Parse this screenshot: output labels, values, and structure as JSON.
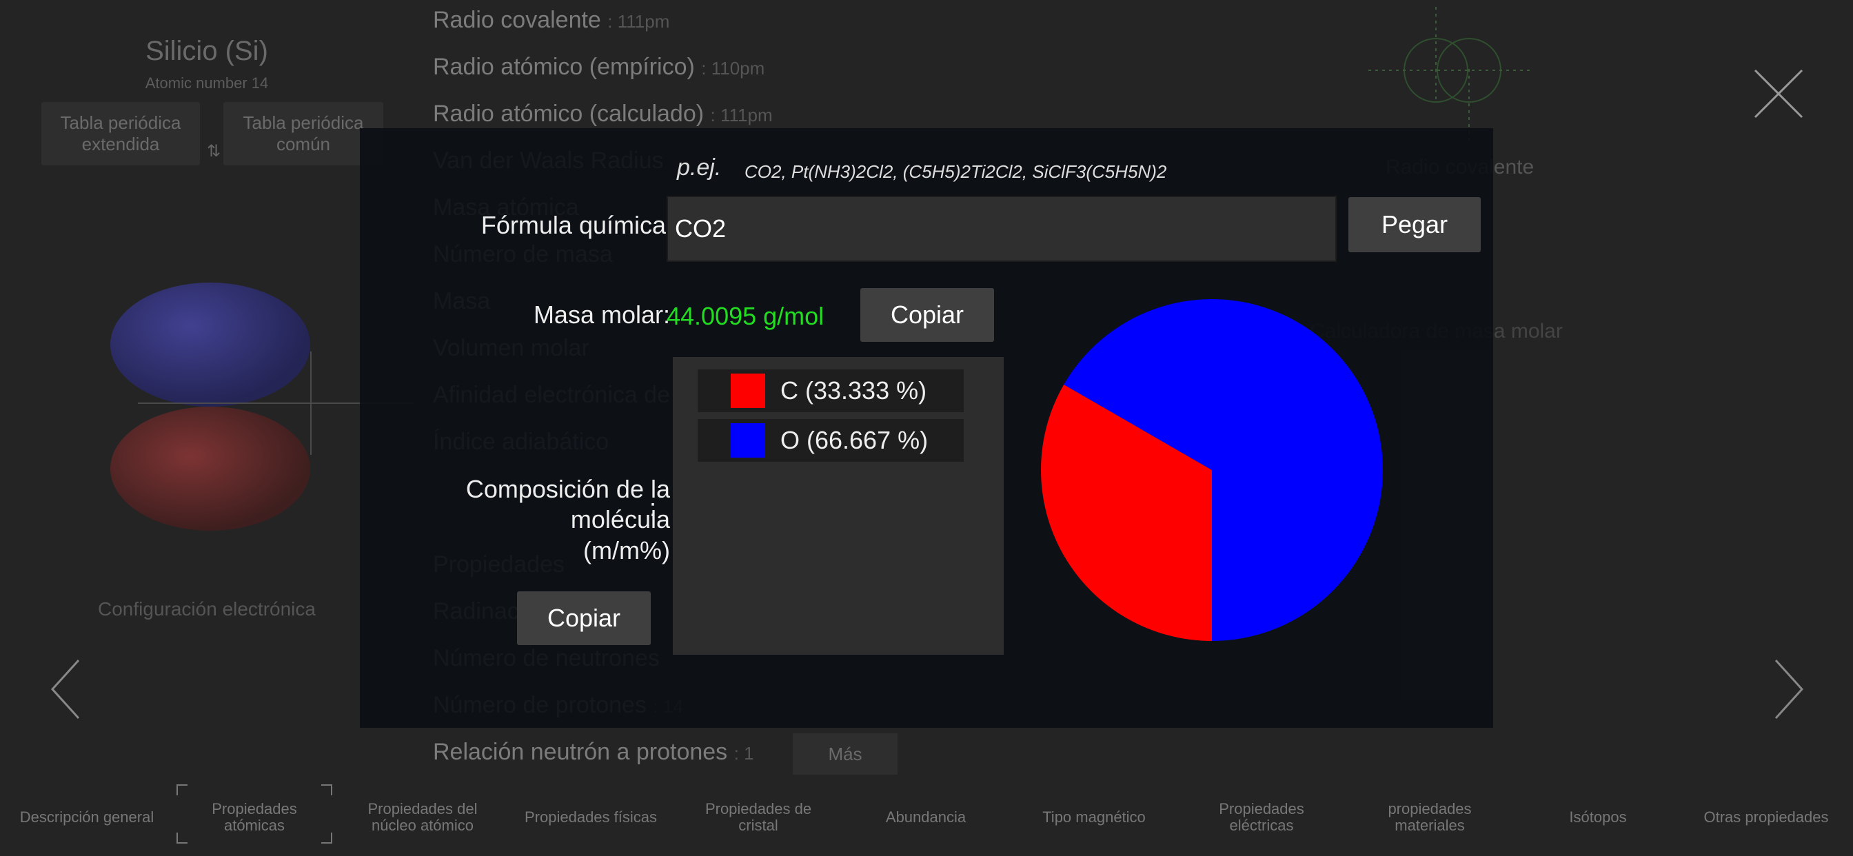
{
  "background": {
    "element_title": "Silicio (Si)",
    "atomic_number": "Atomic number 14",
    "periodic_table_extended": "Tabla periódica\nextendida",
    "periodic_table_common": "Tabla periódica\ncomún",
    "config_label": "Configuración electrónica",
    "props": [
      {
        "label": "Radio covalente",
        "value": ": 111pm"
      },
      {
        "label": "Radio atómico (empírico)",
        "value": ": 110pm"
      },
      {
        "label": "Radio atómico (calculado)",
        "value": ": 111pm"
      },
      {
        "label": "Van der Waals Radius",
        "value": ""
      },
      {
        "label": "Masa atómica",
        "value": ""
      },
      {
        "label": "Número de masa",
        "value": ""
      },
      {
        "label": "Masa",
        "value": ""
      },
      {
        "label": "Volumen molar",
        "value": ""
      },
      {
        "label": "Afinidad electrónica de",
        "value": ""
      },
      {
        "label": "Índice adiabático",
        "value": ""
      },
      {
        "label": "",
        "value": ""
      },
      {
        "label": "Propiedades",
        "value": ""
      },
      {
        "label": "Radinación",
        "value": ""
      },
      {
        "label": "Número de neutrones",
        "value": ""
      },
      {
        "label": "Número de protones",
        "value": ": 14"
      },
      {
        "label": "Relación neutrón a protones",
        "value": ": 1"
      }
    ],
    "more_label": "Más",
    "right_label_1": "Radio covalente",
    "right_label_2": "Calculadora de masa molar",
    "tabs": [
      "Descripción general",
      "Propiedades\natómicas",
      "Propiedades del\nnúcleo atómico",
      "Propiedades físicas",
      "Propiedades de\ncristal",
      "Abundancia",
      "Tipo magnético",
      "Propiedades\neléctricas",
      "propiedades\nmateriales",
      "Isótopos",
      "Otras propiedades"
    ]
  },
  "dialog": {
    "example_prefix": "p.ej.",
    "example_list": "CO2,  Pt(NH3)2Cl2,  (C5H5)2Ti2Cl2,  SiClF3(C5H5N)2",
    "formula_label": "Fórmula química:",
    "formula_value": "CO2",
    "paste_label": "Pegar",
    "molar_mass_label": "Masa molar:",
    "molar_mass_value": "44.0095 g/mol",
    "copy_label": "Copiar",
    "composition_label": "Composición de la\nmolécula\n(m/m%)",
    "composition_colon": ":",
    "legend": [
      {
        "text": "C  (33.333 %)",
        "color": "#ff0000"
      },
      {
        "text": "O  (66.667 %)",
        "color": "#0000ff"
      }
    ]
  },
  "chart_data": {
    "type": "pie",
    "categories": [
      "C",
      "O"
    ],
    "values": [
      33.333,
      66.667
    ],
    "colors": [
      "#ff0000",
      "#0000ff"
    ]
  }
}
